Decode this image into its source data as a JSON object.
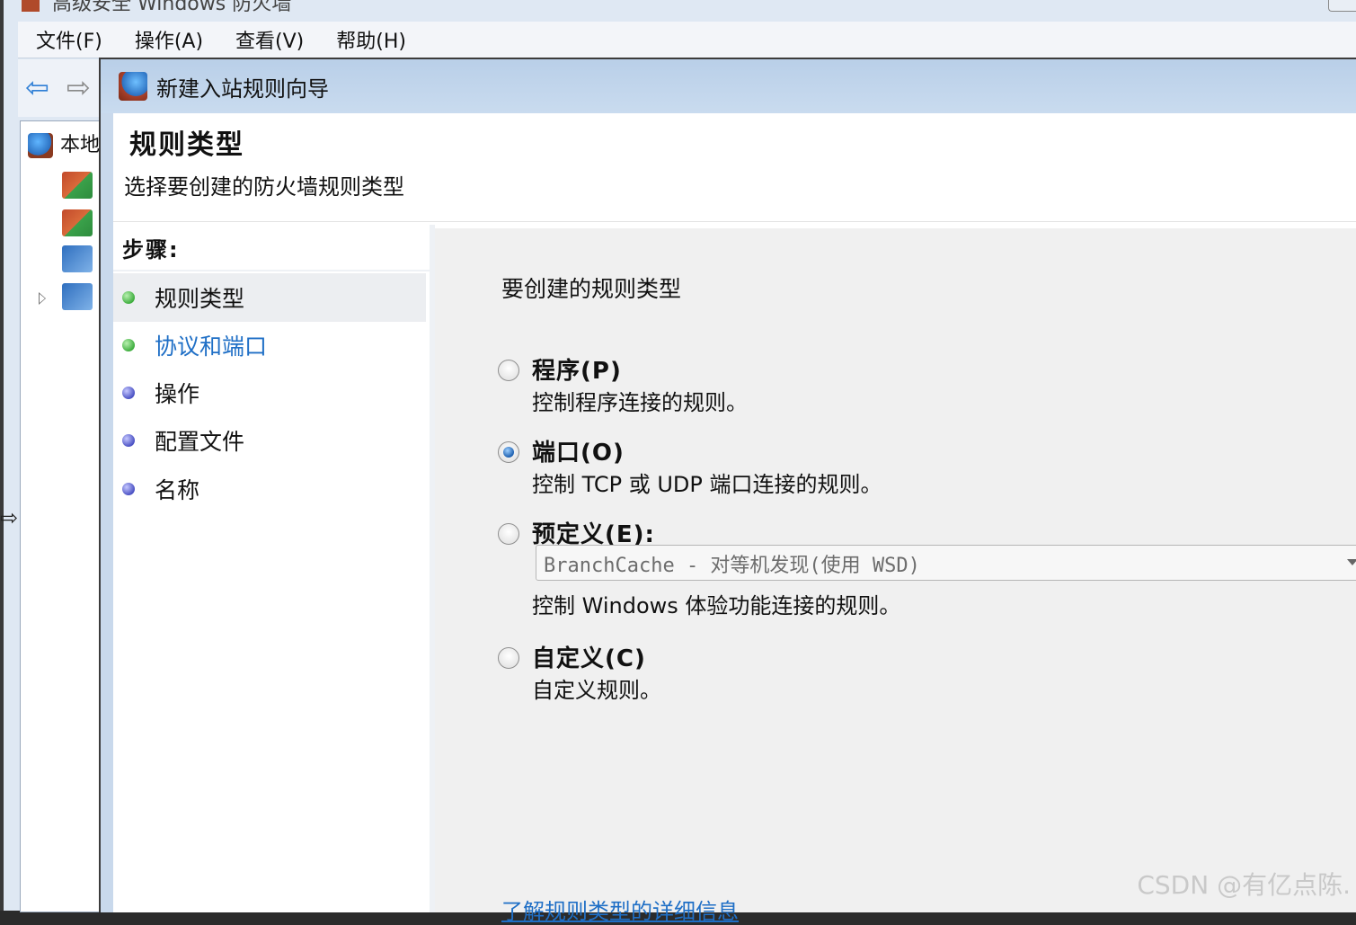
{
  "parent": {
    "title": "高级安全 Windows 防火墙",
    "menu": [
      "文件(F)",
      "操作(A)",
      "查看(V)",
      "帮助(H)"
    ],
    "tree_root": "本地"
  },
  "wizard": {
    "title": "新建入站规则向导",
    "header": {
      "title": "规则类型",
      "subtitle": "选择要创建的防火墙规则类型"
    },
    "steps_label": "步骤:",
    "steps": [
      {
        "label": "规则类型",
        "state": "current"
      },
      {
        "label": "协议和端口",
        "state": "link"
      },
      {
        "label": "操作",
        "state": "pending"
      },
      {
        "label": "配置文件",
        "state": "pending"
      },
      {
        "label": "名称",
        "state": "pending"
      }
    ],
    "question": "要创建的规则类型",
    "options": [
      {
        "label": "程序(P)",
        "desc": "控制程序连接的规则。",
        "checked": false
      },
      {
        "label": "端口(O)",
        "desc": "控制 TCP 或 UDP 端口连接的规则。",
        "checked": true
      },
      {
        "label": "预定义(E):",
        "combo_value": "BranchCache - 对等机发现(使用 WSD)",
        "desc": "控制 Windows 体验功能连接的规则。",
        "checked": false
      },
      {
        "label": "自定义(C)",
        "desc": "自定义规则。",
        "checked": false
      }
    ],
    "learn_more": "了解规则类型的详细信息"
  },
  "watermark": "CSDN @有亿点陈.",
  "colors": {
    "link": "#1f6fc6",
    "title_bar": "#c9dbef",
    "content_bg": "#f0f0f0"
  }
}
